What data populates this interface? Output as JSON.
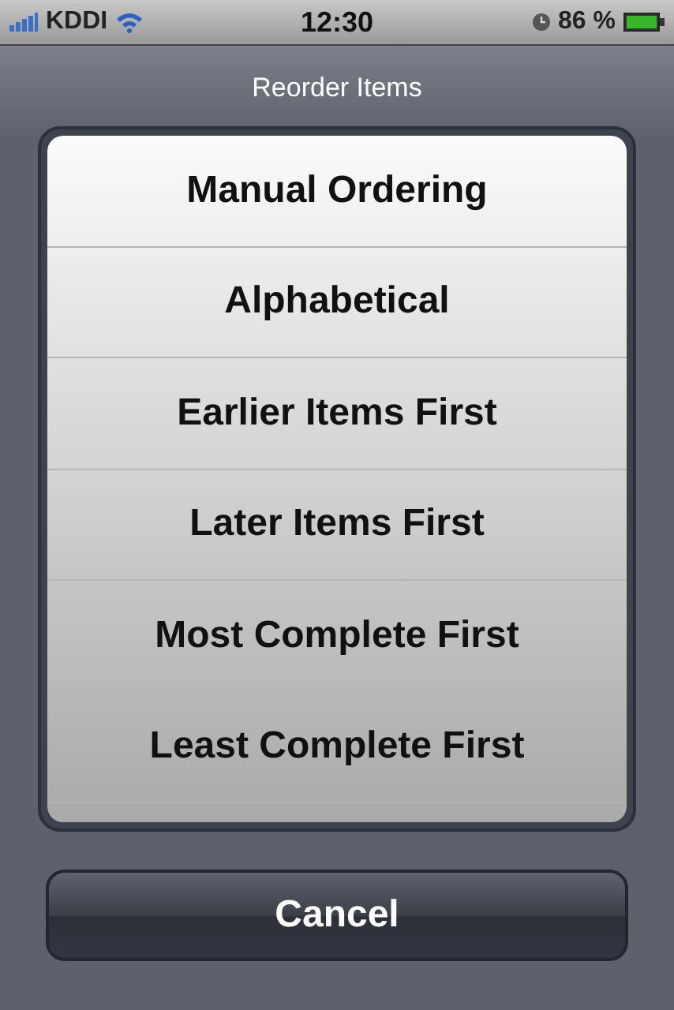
{
  "status_bar": {
    "carrier": "KDDI",
    "time": "12:30",
    "battery_percent": "86 %"
  },
  "sheet": {
    "title": "Reorder Items",
    "options": [
      {
        "label": "Manual Ordering"
      },
      {
        "label": "Alphabetical"
      },
      {
        "label": "Earlier Items First"
      },
      {
        "label": "Later Items First"
      },
      {
        "label": "Most Complete First"
      },
      {
        "label": "Least Complete First"
      }
    ],
    "cancel": "Cancel"
  }
}
